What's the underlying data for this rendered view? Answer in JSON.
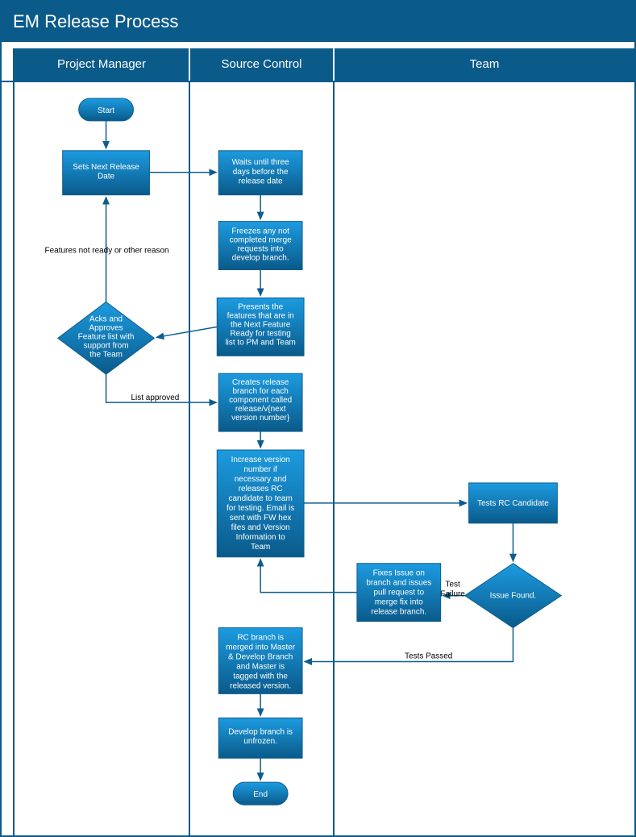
{
  "title": "EM Release Process",
  "lanes": {
    "pm": "Project Manager",
    "sc": "Source Control",
    "team": "Team"
  },
  "nodes": {
    "start": "Start",
    "set_date": [
      "Sets Next Release",
      "Date"
    ],
    "wait": [
      "Waits until three",
      "days before the",
      "release date"
    ],
    "freeze": [
      "Freezes any not",
      "completed merge",
      "requests into",
      "develop branch."
    ],
    "presents": [
      "Presents the",
      "features that are in",
      "the Next Feature",
      "Ready for testing",
      "list to PM and Team"
    ],
    "acks": [
      "Acks and",
      "Approves",
      "Feature list with",
      "support from",
      "the Team"
    ],
    "create_branch": [
      "Creates release",
      "branch for each",
      "component called",
      "release/v{next",
      "version number}"
    ],
    "increase": [
      "Increase version",
      "number if",
      "necessary and",
      "releases RC",
      "candidate to team",
      "for testing. Email is",
      "sent with FW hex",
      "files and Version",
      "Information to",
      "Team"
    ],
    "tests_rc": [
      "Tests RC Candidate"
    ],
    "issue_found": [
      "Issue Found."
    ],
    "fixes": [
      "Fixes Issue on",
      "branch and issues",
      "pull request to",
      "merge fix into",
      "release branch."
    ],
    "rc_merged": [
      "RC branch is",
      "merged into Master",
      "& Develop Branch",
      "and Master is",
      "tagged with the",
      "released version."
    ],
    "unfrozen": [
      "Develop branch is",
      "unfrozen."
    ],
    "end": "End"
  },
  "edge_labels": {
    "not_ready": "Features not ready or other reason",
    "list_approved": "List approved",
    "test_failure": [
      "Test",
      "Failure"
    ],
    "tests_passed": "Tests Passed"
  },
  "colors": {
    "lane_header": "#0a5a8a",
    "node_top": "#1c9be0",
    "node_bottom": "#0a5a8a",
    "node_stroke": "#0d5d8f",
    "arrow": "#0d5d90"
  }
}
